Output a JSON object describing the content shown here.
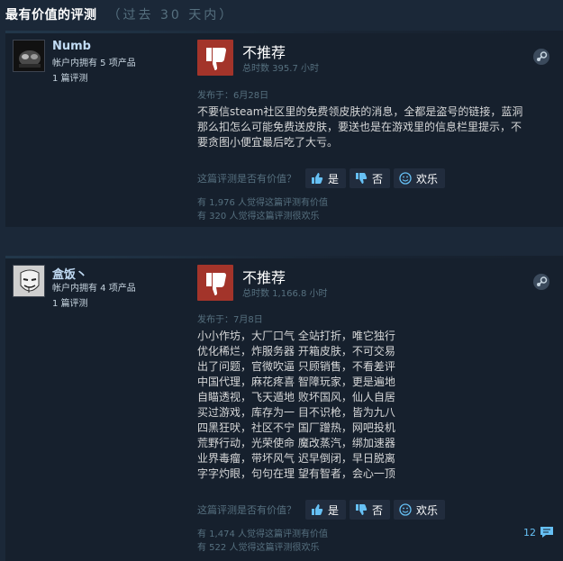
{
  "section": {
    "title": "最有价值的评测",
    "range": "（过去 30 天内）"
  },
  "reviews": [
    {
      "author": {
        "name": "Numb",
        "products": "帐户内拥有 5 项产品",
        "review_count": "1 篇评测"
      },
      "verdict": "不推荐",
      "hours": "总时数 395.7 小时",
      "posted": "发布于：6月28日",
      "text_lines": [
        "不要信steam社区里的免费领皮肤的消息，全都是盗号的链接，蓝洞",
        "那么扣怎么可能免费送皮肤，要送也是在游戏里的信息栏里提示，不",
        "要贪图小便宜最后吃了大亏。"
      ],
      "helpful_question": "这篇评测是否有价值？",
      "buttons": {
        "yes": "是",
        "no": "否",
        "funny": "欢乐"
      },
      "helpful_count": "有 1,976 人觉得这篇评测有价值",
      "funny_count": "有 320 人觉得这篇评测很欢乐"
    },
    {
      "author": {
        "name": "盒饭丶",
        "products": "帐户内拥有 4 项产品",
        "review_count": "1 篇评测"
      },
      "verdict": "不推荐",
      "hours": "总时数 1,166.8 小时",
      "posted": "发布于：7月8日",
      "text_lines": [
        "小小作坊，大厂口气 全站打折，唯它独行",
        "优化稀烂，炸服务器 开箱皮肤，不可交易",
        "出了问题，官微吹逼 只顾销售，不看差评",
        "中国代理，麻花疼喜 智障玩家，更是遍地",
        "自瞄透视，飞天遁地 败坏国风，仙人自居",
        "买过游戏，库存为一 目不识枪，皆为九八",
        "四黑狂吠，社区不宁 国厂蹭热，网吧投机",
        "荒野行动，光荣使命 魔改蒸汽，绑加速器",
        "业界毒瘤，带坏风气 迟早倒闭，早日脱离",
        "字字灼眼，句句在理 望有智者，会心一顶"
      ],
      "helpful_question": "这篇评测是否有价值？",
      "buttons": {
        "yes": "是",
        "no": "否",
        "funny": "欢乐"
      },
      "helpful_count": "有 1,474 人觉得这篇评测有价值",
      "funny_count": "有 522 人觉得这篇评测很欢乐",
      "comment_count": "12"
    }
  ],
  "colors": {
    "background": "#1b2838",
    "card": "#16202d",
    "thumb_down": "#a3342a",
    "link": "#66c0f4",
    "muted": "#56707f"
  },
  "icons": {
    "thumb": "thumbs-down-icon",
    "platform": "steam-icon",
    "yes": "thumbs-up-icon",
    "no": "thumbs-down-icon",
    "funny": "smiley-icon",
    "comments": "comment-bubble-icon"
  }
}
